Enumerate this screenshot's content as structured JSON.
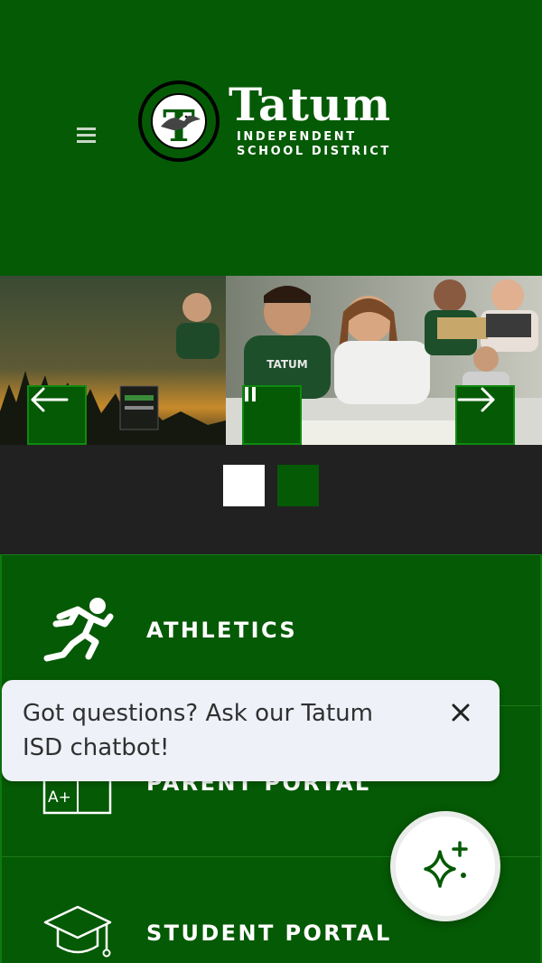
{
  "header": {
    "menu_icon": "hamburger-menu-icon",
    "logo": {
      "seal_letter": "T",
      "seal_ring_text": "TATUM INDEPENDENT SCHOOL DISTRICT",
      "name": "Tatum",
      "subtitle_line1": "INDEPENDENT",
      "subtitle_line2": "SCHOOL DISTRICT"
    }
  },
  "slideshow": {
    "shirt_text": "TATUM",
    "controls": {
      "prev_icon": "arrow-left-icon",
      "pause_icon": "pause-icon",
      "next_icon": "arrow-right-icon"
    },
    "dots": [
      {
        "state": "active"
      },
      {
        "state": "inactive"
      }
    ]
  },
  "quick_links": [
    {
      "label": "ATHLETICS",
      "icon": "runner-icon"
    },
    {
      "label": "PARENT PORTAL",
      "icon": "report-card-icon"
    },
    {
      "label": "STUDENT PORTAL",
      "icon": "graduation-cap-icon"
    }
  ],
  "chat": {
    "prompt": "Got questions? Ask our Tatum ISD chatbot!",
    "close_icon": "close-icon",
    "launcher_icon": "sparkle-icon"
  },
  "colors": {
    "primary_green": "#055a05",
    "dark_bar": "#212121",
    "tooltip_bg": "#eef1f8"
  }
}
